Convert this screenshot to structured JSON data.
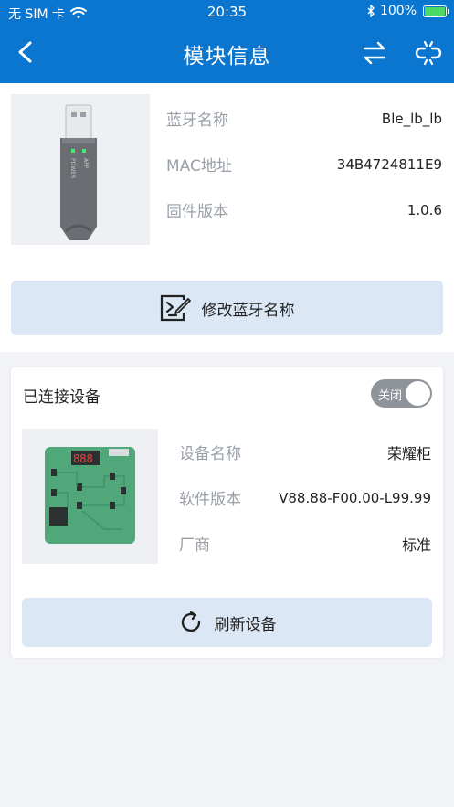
{
  "status_bar": {
    "carrier": "无 SIM 卡",
    "time": "20:35",
    "battery": "100%"
  },
  "nav": {
    "title": "模块信息"
  },
  "module": {
    "rows": [
      {
        "label": "蓝牙名称",
        "value": "Ble_lb_lb"
      },
      {
        "label": "MAC地址",
        "value": "34B4724811E9"
      },
      {
        "label": "固件版本",
        "value": "1.0.6"
      }
    ],
    "dongle_leds": [
      "APP",
      "POWER"
    ],
    "rename_button": "修改蓝牙名称"
  },
  "device": {
    "title": "已连接设备",
    "toggle_label": "关闭",
    "rows": [
      {
        "label": "设备名称",
        "value": "荣耀柜"
      },
      {
        "label": "软件版本",
        "value": "V88.88-F00.00-L99.99"
      },
      {
        "label": "厂商",
        "value": "标准"
      }
    ],
    "board_display": "888",
    "refresh_button": "刷新设备"
  },
  "colors": {
    "header": "#0a76d0",
    "button_bg": "#dce7f6",
    "label": "#9aa0a8",
    "board": "#4fa77a"
  }
}
